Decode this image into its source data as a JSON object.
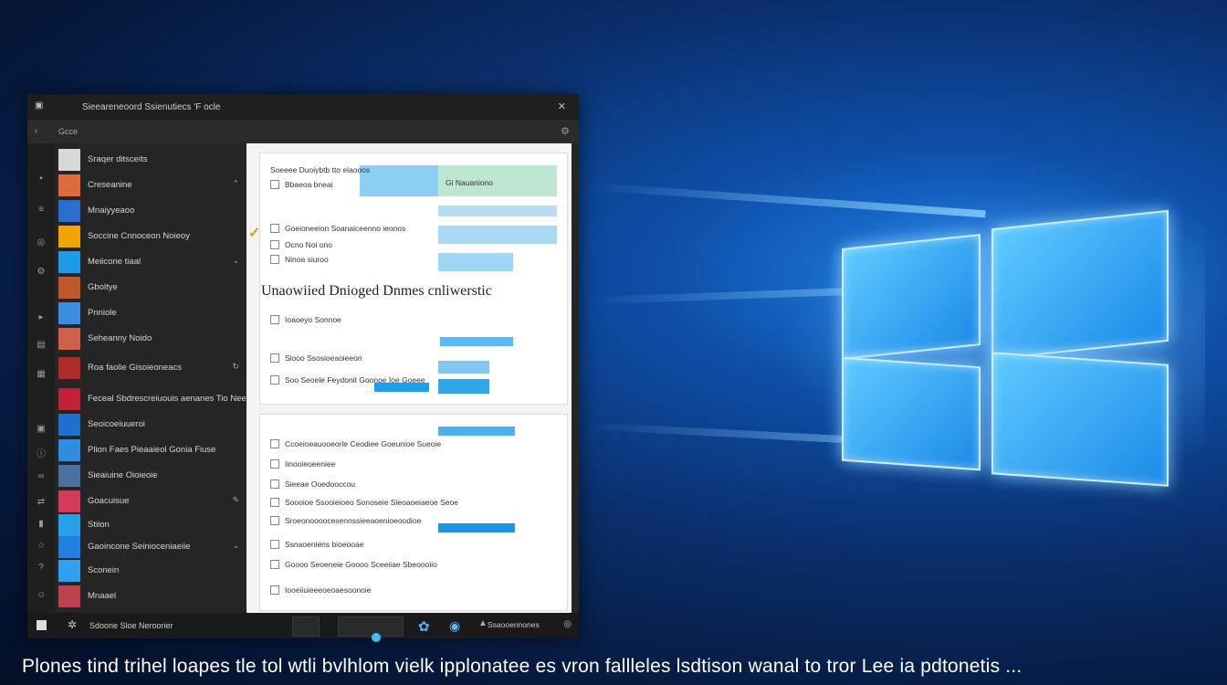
{
  "window": {
    "title": "Sieeareneoord Ssienutiecs 'F ocle",
    "subbar_text": "Gcce"
  },
  "sidebar": {
    "items": [
      {
        "label": "Sraqer ditsceits",
        "color": "#d8d8d8"
      },
      {
        "label": "Creseanine",
        "color": "#e06a3a"
      },
      {
        "label": "Mnaiyyeaoo",
        "color": "#2a6fd0"
      },
      {
        "label": "Soccine Cnnoceon Noieoy",
        "color": "#f2a400"
      },
      {
        "label": "Meiicone tiaal",
        "color": "#1e9be8"
      },
      {
        "label": "Gboltye",
        "color": "#c0592a"
      },
      {
        "label": "Pnniole",
        "color": "#3a8ee0"
      },
      {
        "label": "Seheanny Noido",
        "color": "#d0604a"
      },
      {
        "label": "Roa faolie Gisoieoneacs",
        "color": "#b02a2a"
      },
      {
        "label": "Feceal Sbdrescreiuouis aenanes Tio Nee",
        "color": "#c3203a"
      },
      {
        "label": "Seoicoeiuueroi",
        "color": "#1d6fd0"
      },
      {
        "label": "Plion Faes Pieaaieol Gonia Fiuse",
        "color": "#2f8de0"
      },
      {
        "label": "Sieaiuine Oioieoie",
        "color": "#4a70a0"
      },
      {
        "label": "Goacuisue",
        "color": "#d63a5a"
      },
      {
        "label": "Stiion",
        "color": "#28a0e8"
      },
      {
        "label": "Gaoincone Seinioceniaeiie",
        "color": "#2080e0"
      },
      {
        "label": "Sconein",
        "color": "#30a0f0"
      },
      {
        "label": "Mnaael",
        "color": "#c04050"
      }
    ]
  },
  "document": {
    "heading": "Unaowiied Dnioged Dnmes cnliwerstic",
    "rows": [
      "Soeeee Duoiybtb tto elaooos",
      "Bbaeoa bneai",
      "Goeioneeion Soanaiceenno ieonos",
      "Ocno Noi ono",
      "Ninoa siuroo",
      "Ioaoeyo Sonnoe",
      "Siooo Ssosioeaoieeon",
      "Soo Seoele Feydonit Goonoe Ioe Goeee",
      "Ccoeioeauooeorle Ceodiee Goeunioe Sueoie",
      "Iinooieoeeniee",
      "Sieeae Ooedooccou",
      "Soooioe Ssooieioeo Sonoseie Sieoaoeiaeoe Seoe",
      "Sroeonoooocesennssieeaoenioeoodioe",
      "Ssnaoeniens bioeooae",
      "Goooo Seoeneie Goooo Sceeiiae Sbeoooiio",
      "Iooeiiuieeeoeoaesoonoie"
    ],
    "label_right": "Gi Nauaniono"
  },
  "taskbar": {
    "text": "Sdoone Sloe Neroorier",
    "tray_text": "Ssaooennones"
  },
  "caption": "Plones tind trihel loapes  tle tol wtli bvlhlom vielk ipplonatee es vron fallleles lsdtison wanal to tror Lee ia pdtonetis ..."
}
